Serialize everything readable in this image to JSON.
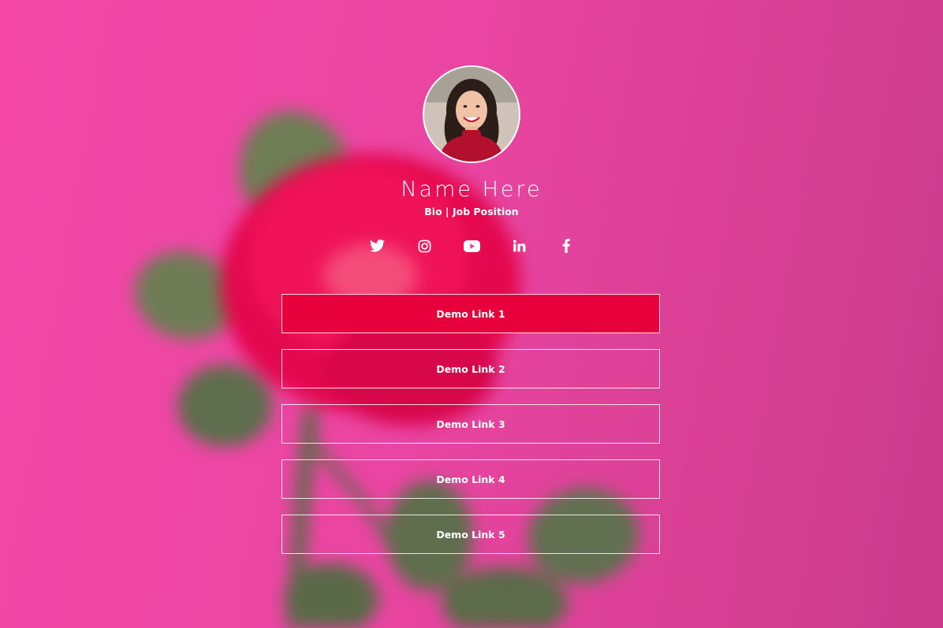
{
  "profile": {
    "name": "Name Here",
    "bio": "Bio | Job Position"
  },
  "socials": [
    {
      "icon": "twitter-icon"
    },
    {
      "icon": "instagram-icon"
    },
    {
      "icon": "youtube-icon"
    },
    {
      "icon": "linkedin-icon"
    },
    {
      "icon": "facebook-icon"
    }
  ],
  "links": [
    {
      "label": "Demo Link 1"
    },
    {
      "label": "Demo Link 2"
    },
    {
      "label": "Demo Link 3"
    },
    {
      "label": "Demo Link 4"
    },
    {
      "label": "Demo Link 5"
    }
  ],
  "colors": {
    "background": "#ea45a2",
    "accent_link": "#e8003d",
    "text": "#ffffff"
  }
}
